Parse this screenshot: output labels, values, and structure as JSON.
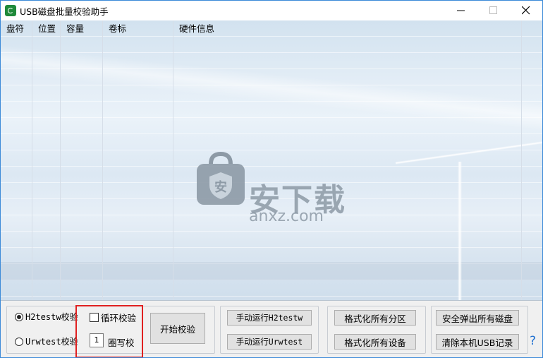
{
  "window": {
    "title": "USB磁盘批量校验助手"
  },
  "list": {
    "columns": [
      "盘符",
      "位置",
      "容量",
      "卷标",
      "硬件信息"
    ],
    "rows": []
  },
  "watermark": {
    "text": "安下载",
    "sub": "anxz.com"
  },
  "mode": {
    "options": [
      "H2testw校验",
      "Urwtest校验"
    ],
    "selected": "H2testw校验"
  },
  "loop": {
    "checkbox_label": "循环校验",
    "checked": false,
    "count_value": "1",
    "count_label": "圈写校"
  },
  "buttons": {
    "start": "开始校验",
    "run_h2testw": "手动运行H2testw",
    "run_urwtest": "手动运行Urwtest",
    "format_partitions": "格式化所有分区",
    "format_devices": "格式化所有设备",
    "eject_all": "安全弹出所有磁盘",
    "clear_usb_records": "清除本机USB记录",
    "help": "?"
  },
  "colors": {
    "accent": "#3c8ad8",
    "highlight": "#e02020",
    "help": "#1e6fd0"
  }
}
